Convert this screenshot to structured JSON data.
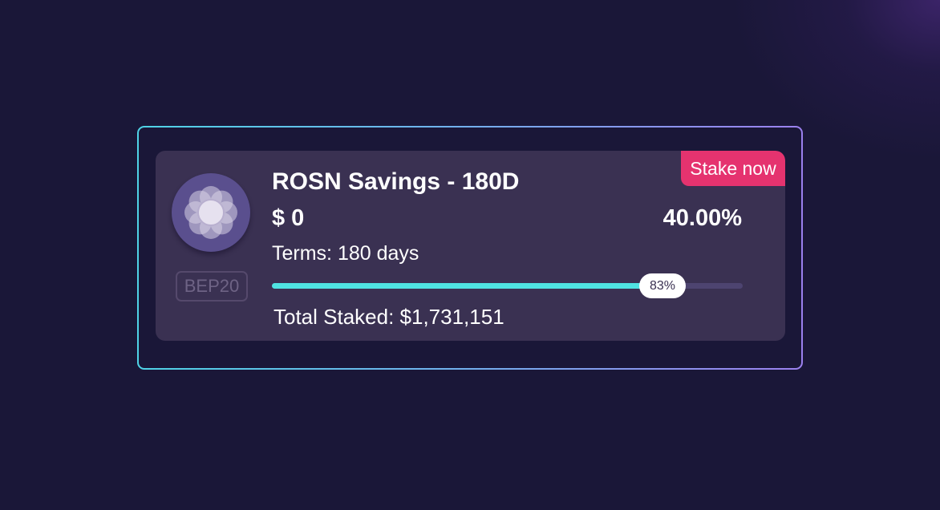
{
  "card": {
    "stake_button": "Stake now",
    "title": "ROSN Savings - 180D",
    "balance": "$ 0",
    "apy": "40.00%",
    "terms": "Terms: 180 days",
    "network": "BEP20",
    "progress_percent": 83,
    "progress_label": "83%",
    "total_staked": "Total Staked: $1,731,151",
    "token_icon": "flower-logo-icon"
  },
  "colors": {
    "page_background": "#1a1738",
    "card_background": "#3a3152",
    "accent_pink": "#e5336f",
    "progress_fill": "#4fe3e1",
    "progress_track": "#4d4470",
    "border_gradient_start": "#4fd3e6",
    "border_gradient_end": "#9b80ee"
  }
}
